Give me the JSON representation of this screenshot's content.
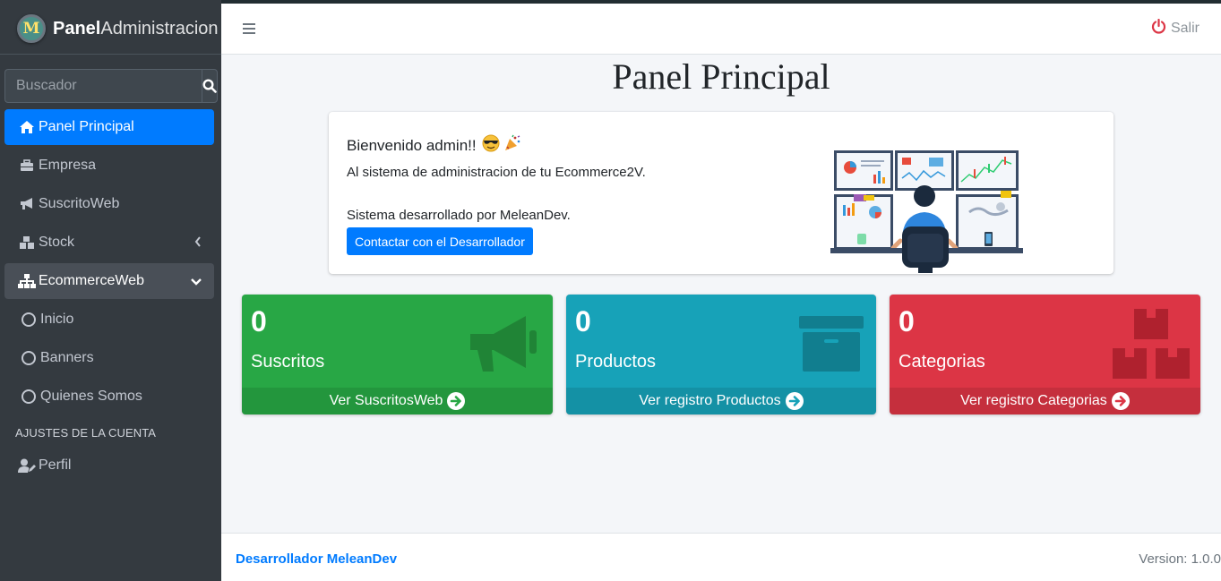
{
  "brand": {
    "logo_letter": "M",
    "name_bold": "Panel",
    "name_rest": "Administracion"
  },
  "search": {
    "placeholder": "Buscador"
  },
  "sidebar": {
    "items": [
      {
        "label": "Panel Principal",
        "icon": "home-icon"
      },
      {
        "label": "Empresa",
        "icon": "briefcase-icon"
      },
      {
        "label": "SuscritoWeb",
        "icon": "bullhorn-icon"
      },
      {
        "label": "Stock",
        "icon": "boxes-icon"
      },
      {
        "label": "EcommerceWeb",
        "icon": "sitemap-icon"
      },
      {
        "label": "Inicio",
        "icon": "circle-icon"
      },
      {
        "label": "Banners",
        "icon": "circle-icon"
      },
      {
        "label": "Quienes Somos",
        "icon": "circle-icon"
      }
    ],
    "section_header": "AJUSTES DE LA CUENTA",
    "profile_label": "Perfil"
  },
  "navbar": {
    "logout_label": "Salir"
  },
  "page": {
    "title": "Panel Principal"
  },
  "welcome": {
    "greeting": "Bienvenido admin!!",
    "line1": "Al sistema de administracion de tu Ecommerce2V.",
    "line2": "Sistema desarrollado por MeleanDev.",
    "button": "Contactar con el Desarrollador"
  },
  "stats": [
    {
      "value": "0",
      "label": "Suscritos",
      "link": "Ver SuscritosWeb",
      "color": "#28a745",
      "icon": "bullhorn-icon"
    },
    {
      "value": "0",
      "label": "Productos",
      "link": "Ver registro Productos",
      "color": "#17a2b8",
      "icon": "archive-icon"
    },
    {
      "value": "0",
      "label": "Categorias",
      "link": "Ver registro Categorias",
      "color": "#dc3545",
      "icon": "boxes-icon"
    }
  ],
  "footer": {
    "developer": "Desarrollador MeleanDev",
    "version": "Version: 1.0.0"
  },
  "colors": {
    "primary": "#007bff",
    "sidebar": "#343a40"
  }
}
